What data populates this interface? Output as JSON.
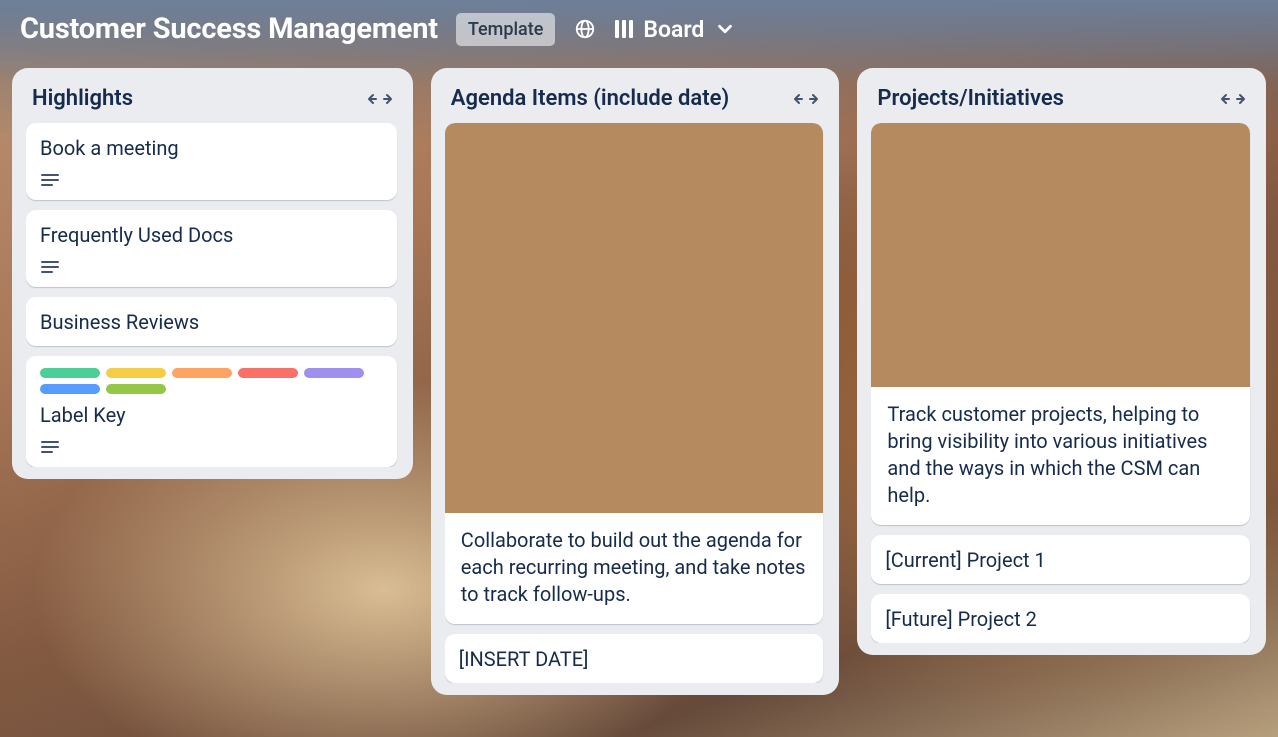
{
  "header": {
    "title": "Customer Success Management",
    "template_badge": "Template",
    "view_label": "Board"
  },
  "label_colors": [
    "#4bce97",
    "#f5cd47",
    "#fea362",
    "#f87168",
    "#9f8fef",
    "#579dff",
    "#94c748"
  ],
  "lists": [
    {
      "title": "Highlights",
      "cards": [
        {
          "title": "Book a meeting",
          "has_description": true
        },
        {
          "title": "Frequently Used Docs",
          "has_description": true
        },
        {
          "title": "Business Reviews"
        },
        {
          "title": "Label Key",
          "has_description": true,
          "labels_count": 7
        }
      ]
    },
    {
      "title": "Agenda Items (include date)",
      "cards": [
        {
          "cover": "notebook",
          "title": "Collaborate to build out the agenda for each recurring meeting, and take notes to track follow-ups."
        },
        {
          "title": "[INSERT DATE]"
        }
      ]
    },
    {
      "title": "Projects/Initiatives",
      "cards": [
        {
          "cover": "laptops",
          "title": "Track customer projects, helping to bring visibility into various initiatives and the ways in which the CSM can help."
        },
        {
          "title": "[Current] Project 1"
        },
        {
          "title": "[Future] Project 2"
        }
      ]
    }
  ]
}
